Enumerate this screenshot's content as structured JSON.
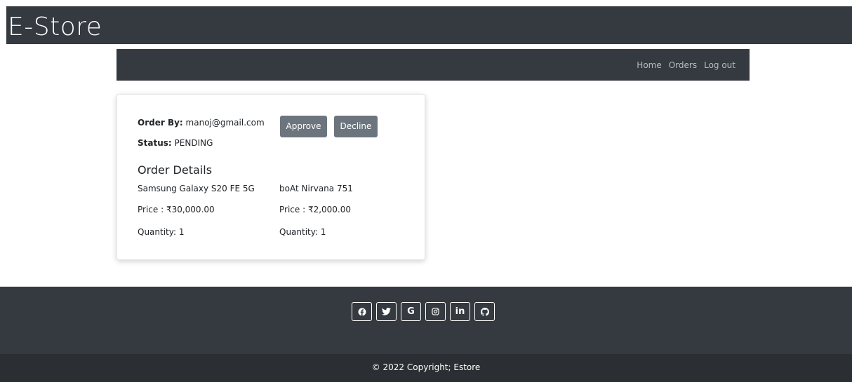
{
  "header": {
    "brand": "E-Store"
  },
  "nav": {
    "items": [
      {
        "label": "Home"
      },
      {
        "label": "Orders"
      },
      {
        "label": "Log out"
      }
    ]
  },
  "order": {
    "order_by_label": "Order By:",
    "order_by_value": "manoj@gmail.com",
    "status_label": "Status:",
    "status_value": "PENDING",
    "approve_label": "Approve",
    "decline_label": "Decline",
    "details_title": "Order Details",
    "items": [
      {
        "name": "Samsung Galaxy S20 FE 5G",
        "price": "Price : ₹30,000.00",
        "quantity": "Quantity: 1"
      },
      {
        "name": "boAt Nirvana 751",
        "price": "Price : ₹2,000.00",
        "quantity": "Quantity: 1"
      }
    ]
  },
  "footer": {
    "social_icons": [
      "facebook-icon",
      "twitter-icon",
      "google-icon",
      "instagram-icon",
      "linkedin-icon",
      "github-icon"
    ],
    "copyright": "© 2022 Copyright; Estore"
  },
  "colors": {
    "dark": "#343a40",
    "footer_bottom": "#2b2e33",
    "button": "#6c757d"
  }
}
